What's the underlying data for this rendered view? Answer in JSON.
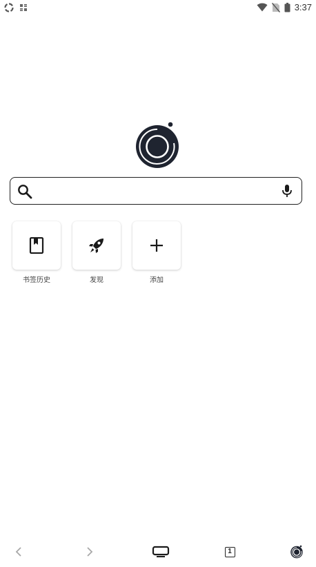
{
  "status_bar": {
    "time": "3:37"
  },
  "search": {
    "value": "",
    "placeholder": ""
  },
  "tiles": [
    {
      "label": "书签历史",
      "icon": "bookmark-book-icon"
    },
    {
      "label": "发现",
      "icon": "rocket-icon"
    },
    {
      "label": "添加",
      "icon": "plus-icon"
    }
  ],
  "bottom_nav": {
    "tab_count": "1"
  },
  "colors": {
    "logo_dark": "#1f2430",
    "text": "#222222",
    "nav_disabled": "#a8a8a8"
  }
}
